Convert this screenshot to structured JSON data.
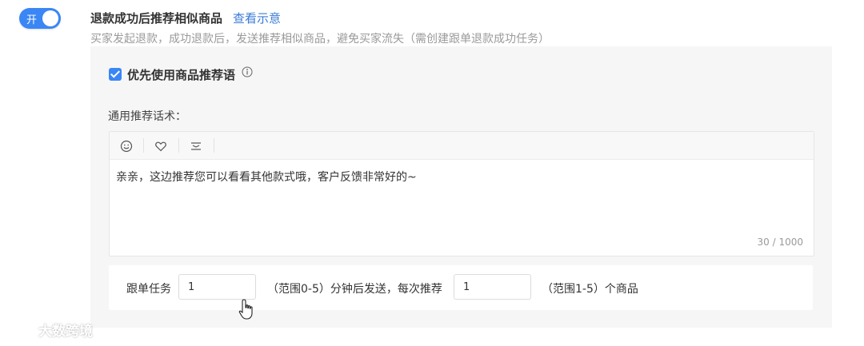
{
  "toggle": {
    "label": "开",
    "state": "on",
    "color": "#3a86f5"
  },
  "setting": {
    "title": "退款成功后推荐相似商品",
    "demo_link": "查看示意",
    "description": "买家发起退款，成功退款后，发送推荐相似商品，避免买家流失（需创建跟单退款成功任务）"
  },
  "panel": {
    "checkbox_label": "优先使用商品推荐语",
    "checkbox_checked": true,
    "script_label": "通用推荐话术：",
    "toolbar_icons": [
      "smile-icon",
      "heart-icon",
      "text-align-icon"
    ],
    "editor_text": "亲亲，这边推荐您可以看看其他款式哦，客户反馈非常好的~",
    "counter": "30 / 1000",
    "followup": {
      "prefix": "跟单任务",
      "delay_value": "1",
      "delay_hint": "（范围0-5）分钟后发送，每次推荐",
      "count_value": "1",
      "count_hint": "（范围1-5）个商品"
    }
  },
  "watermark": "大数跨境",
  "colors": {
    "accent": "#3a86f5",
    "link": "#3a7bd5",
    "panel_bg": "#f6f6f6"
  }
}
